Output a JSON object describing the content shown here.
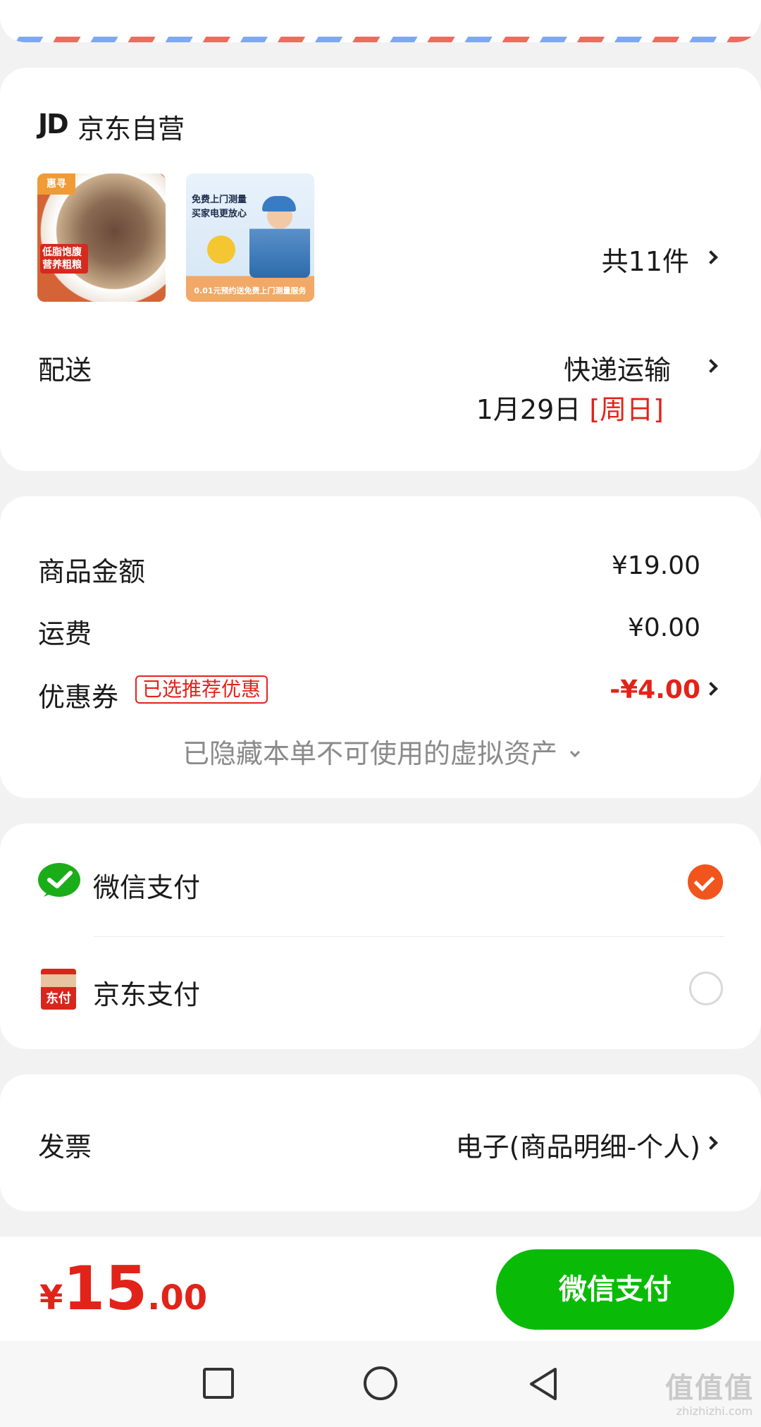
{
  "shop": {
    "logo": "JD",
    "name": "京东自营",
    "rice_tag": "惠寻",
    "rice_label": "低脂饱腹\n营养粗粮",
    "service_text": "免费上门测量\n买家电更放心",
    "service_bottom": "0.01元预约送免费上门测量服务",
    "item_count": "共11件",
    "delivery_label": "配送",
    "delivery_method": "快递运输",
    "delivery_date": "1月29日",
    "delivery_weekday": "[周日]"
  },
  "price": {
    "goods_label": "商品金额",
    "goods_value": "¥19.00",
    "shipping_label": "运费",
    "shipping_value": "¥0.00",
    "coupon_label": "优惠券",
    "coupon_badge": "已选推荐优惠",
    "coupon_value": "-¥4.00",
    "hidden_assets": "已隐藏本单不可使用的虚拟资产"
  },
  "payment": {
    "methods": [
      {
        "label": "微信支付",
        "icon": "wechat-pay-icon",
        "selected": true
      },
      {
        "label": "京东支付",
        "icon": "jd-pay-icon",
        "selected": false
      }
    ],
    "jdpay_icon_text": "东付"
  },
  "invoice": {
    "label": "发票",
    "value": "电子(商品明细-个人)"
  },
  "bottom": {
    "currency": "¥",
    "total_int": "15",
    "total_dec": ".00",
    "pay_button": "微信支付"
  },
  "watermark": {
    "text": "值值值",
    "url": "zhizhizhi.com"
  },
  "colors": {
    "accent_red": "#e2231a",
    "wechat_green": "#09bb07",
    "checked_orange": "#f2541d"
  }
}
